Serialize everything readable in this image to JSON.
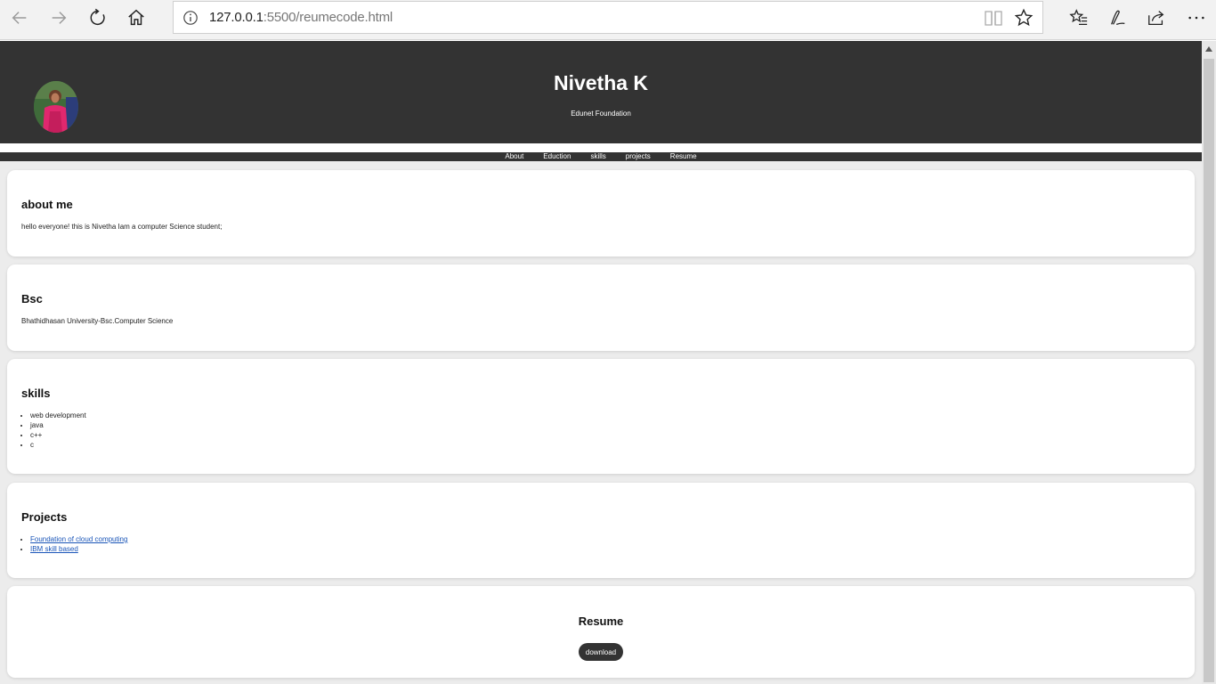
{
  "browser": {
    "url_host": "127.0.0.1",
    "url_rest": ":5500/reumecode.html"
  },
  "header": {
    "name": "Nivetha K",
    "subtitle": "Edunet Foundation"
  },
  "nav": {
    "items": [
      "About",
      "Eduction",
      "skills",
      "projects",
      "Resume"
    ]
  },
  "about": {
    "title": "about me",
    "text": "hello everyone! this is Nivetha Iam a computer Science student;"
  },
  "education": {
    "title": "Bsc",
    "text": "Bhathidhasan University-Bsc.Computer Science"
  },
  "skills": {
    "title": "skills",
    "items": [
      "web development",
      "java",
      "c++",
      "c"
    ]
  },
  "projects": {
    "title": "Projects",
    "items": [
      "Foundation of cloud computing",
      "IBM skill based"
    ]
  },
  "resume": {
    "title": "Resume",
    "button": "download"
  },
  "colors": {
    "header_bg": "#333333",
    "page_bg": "#ececec",
    "card_bg": "#ffffff",
    "link": "#1a55b8"
  }
}
